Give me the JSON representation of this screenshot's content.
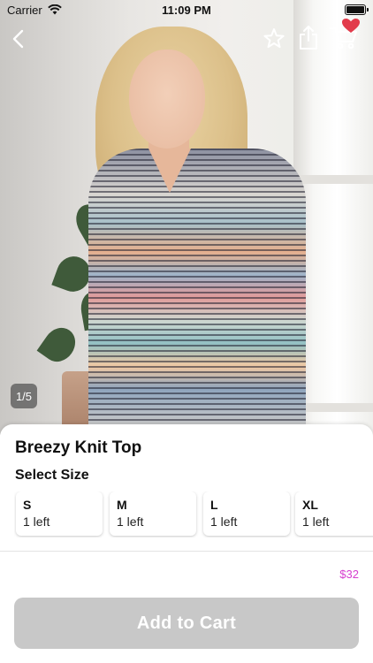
{
  "status_bar": {
    "carrier": "Carrier",
    "time": "11:09 PM"
  },
  "nav": {
    "back_icon": "chevron-left-icon",
    "favorite_icon": "star-icon",
    "share_icon": "share-icon",
    "cart_icon": "cart-icon",
    "cart_badge_icon": "heart-icon"
  },
  "gallery": {
    "counter": "1/5"
  },
  "product": {
    "title": "Breezy Knit Top",
    "size_heading": "Select Size",
    "sizes": [
      {
        "label": "S",
        "stock": "1 left"
      },
      {
        "label": "M",
        "stock": "1 left"
      },
      {
        "label": "L",
        "stock": "1 left"
      },
      {
        "label": "XL",
        "stock": "1 left"
      }
    ],
    "price": "$32",
    "add_to_cart_label": "Add to Cart"
  },
  "colors": {
    "price": "#d63fcf",
    "button_disabled": "#c8c8c8",
    "badge": "#e23b4b"
  }
}
